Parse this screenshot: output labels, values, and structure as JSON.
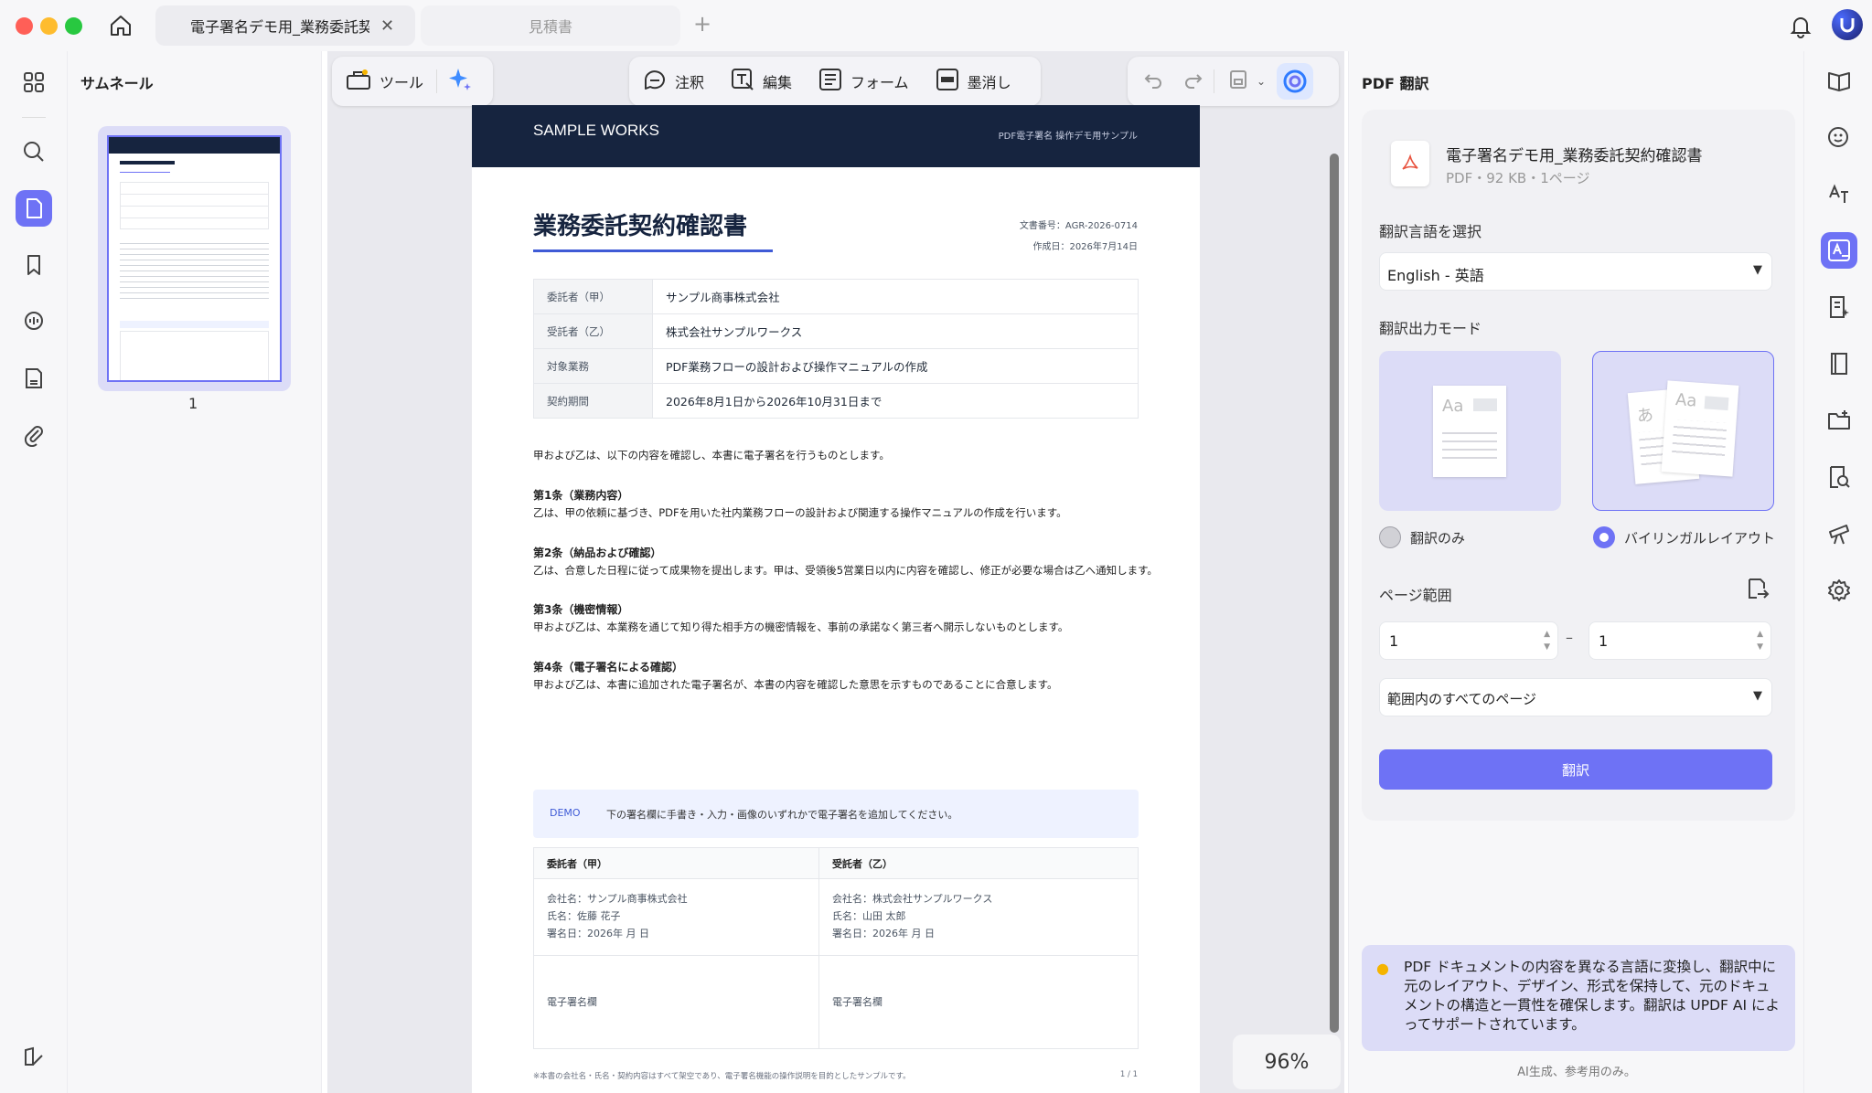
{
  "tabs": [
    {
      "label": "電子署名デモ用_業務委託契約確認書"
    },
    {
      "label": "見積書"
    }
  ],
  "thumbnail_panel": {
    "title": "サムネール",
    "page_number": "1"
  },
  "toolbar": {
    "tools_label": "ツール",
    "annotate": "注釈",
    "edit": "編集",
    "form": "フォーム",
    "redact": "墨消し"
  },
  "zoom": "96%",
  "document": {
    "header_brand": "SAMPLE WORKS",
    "header_sub": "PDF電子署名 操作デモ用サンプル",
    "title": "業務委託契約確認書",
    "doc_no": "文書番号：AGR-2026-0714",
    "created": "作成日：2026年7月14日",
    "info_rows": [
      {
        "key": "委託者（甲）",
        "value": "サンプル商事株式会社"
      },
      {
        "key": "受託者（乙）",
        "value": "株式会社サンプルワークス"
      },
      {
        "key": "対象業務",
        "value": "PDF業務フローの設計および操作マニュアルの作成"
      },
      {
        "key": "契約期間",
        "value": "2026年8月1日から2026年10月31日まで"
      }
    ],
    "intro": "甲および乙は、以下の内容を確認し、本書に電子署名を行うものとします。",
    "articles": [
      {
        "heading": "第1条（業務内容）",
        "body": "乙は、甲の依頼に基づき、PDFを用いた社内業務フローの設計および関連する操作マニュアルの作成を行います。"
      },
      {
        "heading": "第2条（納品および確認）",
        "body": "乙は、合意した日程に従って成果物を提出します。甲は、受領後5営業日以内に内容を確認し、修正が必要な場合は乙へ通知します。"
      },
      {
        "heading": "第3条（機密情報）",
        "body": "甲および乙は、本業務を通じて知り得た相手方の機密情報を、事前の承諾なく第三者へ開示しないものとします。"
      },
      {
        "heading": "第4条（電子署名による確認）",
        "body": "甲および乙は、本書に追加された電子署名が、本書の内容を確認した意思を示すものであることに合意します。"
      }
    ],
    "demo_badge": "DEMO",
    "demo_text": "下の署名欄に手書き・入力・画像のいずれかで電子署名を追加してください。",
    "sig_parties": [
      {
        "header": "委託者（甲）",
        "company": "会社名：サンプル商事株式会社",
        "name": "氏名：佐藤 花子",
        "date": "署名日：2026年 月 日",
        "field": "電子署名欄"
      },
      {
        "header": "受託者（乙）",
        "company": "会社名：株式会社サンプルワークス",
        "name": "氏名：山田 太郎",
        "date": "署名日：2026年 月 日",
        "field": "電子署名欄"
      }
    ],
    "footer_note": "※本書の会社名・氏名・契約内容はすべて架空であり、電子署名機能の操作説明を目的としたサンプルです。",
    "footer_page": "1 / 1"
  },
  "translate_panel": {
    "title": "PDF 翻訳",
    "file_name": "電子署名デモ用_業務委託契約確認書",
    "file_meta": "PDF・92 KB・1ページ",
    "lang_label": "翻訳言語を選択",
    "lang_value": "English - 英語",
    "mode_label": "翻訳出力モード",
    "mode_only": "翻訳のみ",
    "mode_bilingual": "バイリンガルレイアウト",
    "thumb_aa": "Aa",
    "thumb_a": "あ",
    "range_label": "ページ範囲",
    "range_from": "1",
    "range_dash": "–",
    "range_to": "1",
    "range_option": "範囲内のすべてのページ",
    "translate_button": "翻訳",
    "info_text": "PDF ドキュメントの内容を異なる言語に変換し、翻訳中に元のレイアウト、デザイン、形式を保持して、元のドキュメントの構造と一貫性を確保します。翻訳は UPDF AI によってサポートされています。",
    "ai_note": "AI生成、参考用のみ。"
  },
  "colors": {
    "accent": "#6e72f5",
    "doc_header": "#16243f",
    "selected_bg": "#dcdcf7"
  }
}
